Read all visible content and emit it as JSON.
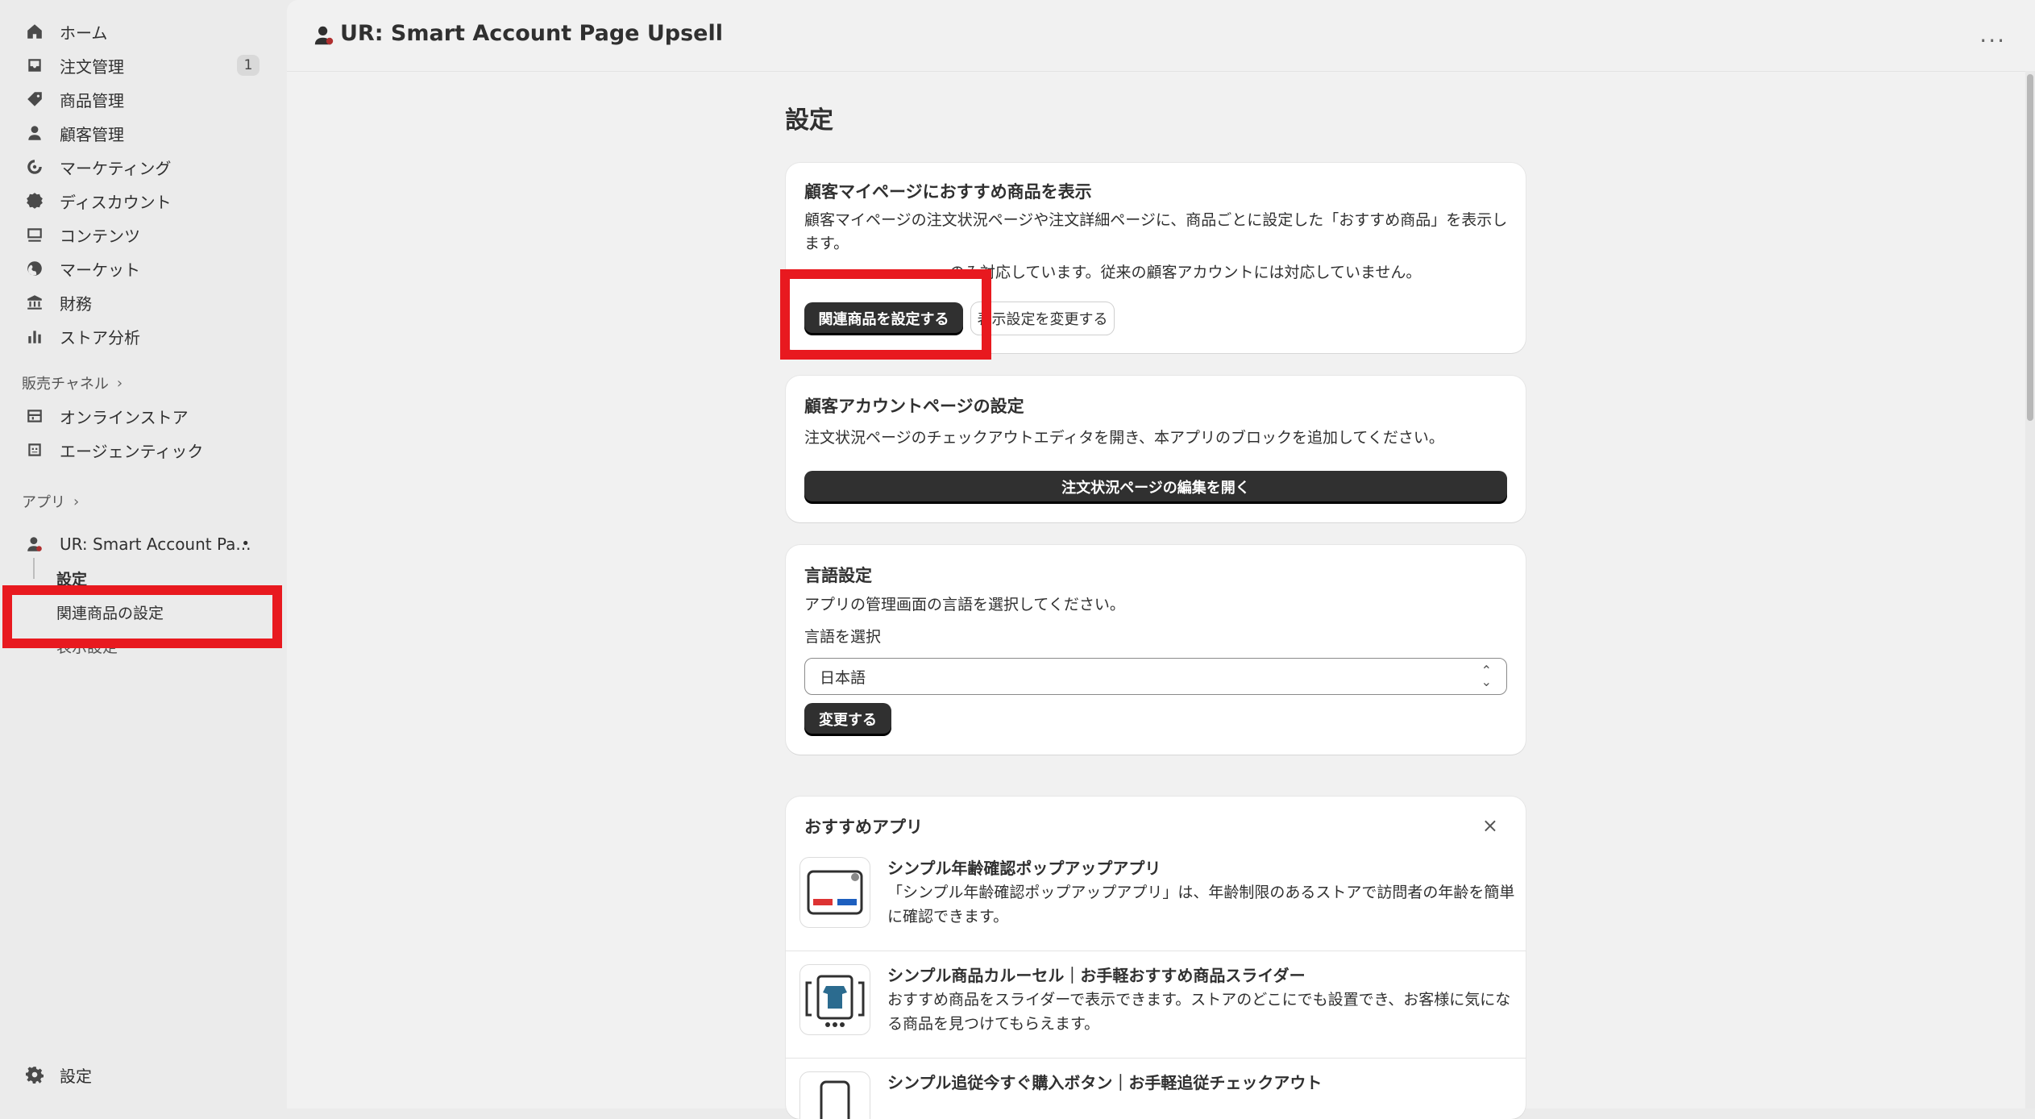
{
  "sidebar": {
    "items": [
      {
        "label": "ホーム",
        "icon": "home-icon"
      },
      {
        "label": "注文管理",
        "icon": "inbox-icon",
        "badge": "1"
      },
      {
        "label": "商品管理",
        "icon": "tag-icon"
      },
      {
        "label": "顧客管理",
        "icon": "person-icon"
      },
      {
        "label": "マーケティング",
        "icon": "target-icon"
      },
      {
        "label": "ディスカウント",
        "icon": "discount-icon"
      },
      {
        "label": "コンテンツ",
        "icon": "image-icon"
      },
      {
        "label": "マーケット",
        "icon": "globe-icon"
      },
      {
        "label": "財務",
        "icon": "bank-icon"
      },
      {
        "label": "ストア分析",
        "icon": "chart-icon"
      }
    ],
    "sales_channels_label": "販売チャネル",
    "channels": [
      {
        "label": "オンラインストア",
        "icon": "store-icon"
      },
      {
        "label": "エージェンティック",
        "icon": "bot-icon"
      }
    ],
    "apps_label": "アプリ",
    "app": {
      "label": "UR: Smart Account Pa...",
      "icon": "app-icon"
    },
    "app_sub_items": [
      "設定",
      "関連商品の設定",
      "表示設定"
    ],
    "settings_label": "設定"
  },
  "header": {
    "title": "UR: Smart Account Page Upsell",
    "more": "···"
  },
  "main": {
    "page_title": "設定",
    "card1": {
      "title": "顧客マイページにおすすめ商品を表示",
      "text": "顧客マイページの注文状況ページや注文詳細ページに、商品ごとに設定した「おすすめ商品」を表示します。",
      "note": "のみ対応しています。従来の顧客アカウントには対応していません。",
      "primary_button": "関連商品を設定する",
      "secondary_button": "表示設定を変更する"
    },
    "card2": {
      "title": "顧客アカウントページの設定",
      "text": "注文状況ページのチェックアウトエディタを開き、本アプリのブロックを追加してください。",
      "button": "注文状況ページの編集を開く"
    },
    "card3": {
      "title": "言語設定",
      "text": "アプリの管理画面の言語を選択してください。",
      "select_label": "言語を選択",
      "select_value": "日本語",
      "button": "変更する"
    },
    "recommended": {
      "title": "おすすめアプリ",
      "close": "×",
      "apps": [
        {
          "name": "シンプル年齢確認ポップアップアプリ",
          "desc": "「シンプル年齢確認ポップアップアプリ」は、年齢制限のあるストアで訪問者の年齢を簡単に確認できます。"
        },
        {
          "name": "シンプル商品カルーセル｜お手軽おすすめ商品スライダー",
          "desc": "おすすめ商品をスライダーで表示できます。ストアのどこにでも設置でき、お客様に気になる商品を見つけてもらえます。"
        },
        {
          "name": "シンプル追従今すぐ購入ボタン｜お手軽追従チェックアウト",
          "desc": ""
        }
      ]
    }
  },
  "colors": {
    "highlight": "#e8191f",
    "primary_button": "#303030",
    "background": "#f1f1f1"
  }
}
